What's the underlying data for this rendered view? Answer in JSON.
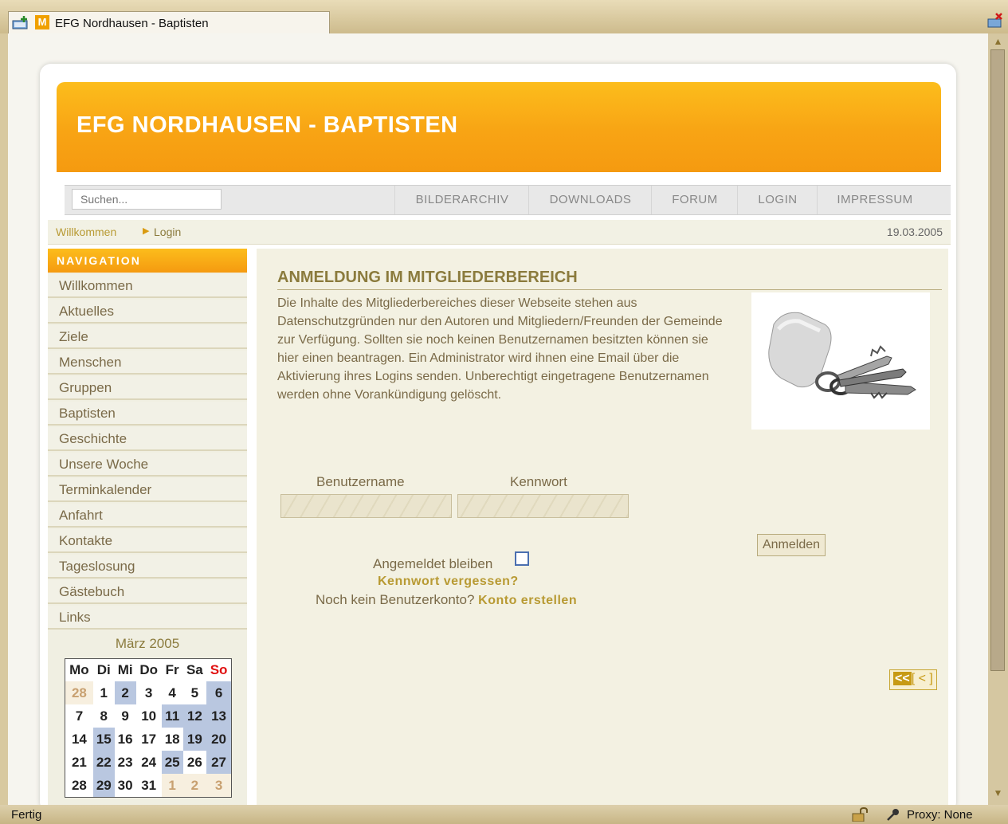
{
  "browser": {
    "tab_title": "EFG Nordhausen - Baptisten",
    "status_text": "Fertig",
    "proxy_text": "Proxy: None"
  },
  "site": {
    "banner_title": "EFG NORDHAUSEN - BAPTISTEN",
    "search_placeholder": "Suchen...",
    "topnav": [
      "BILDERARCHIV",
      "DOWNLOADS",
      "FORUM",
      "LOGIN",
      "IMPRESSUM"
    ],
    "breadcrumb": [
      "Willkommen",
      "Login"
    ],
    "date": "19.03.2005"
  },
  "sidebar": {
    "header": "NAVIGATION",
    "items": [
      "Willkommen",
      "Aktuelles",
      "Ziele",
      "Menschen",
      "Gruppen",
      "Baptisten",
      "Geschichte",
      "Unsere Woche",
      "Terminkalender",
      "Anfahrt",
      "Kontakte",
      "Tageslosung",
      "Gästebuch",
      "Links"
    ]
  },
  "calendar": {
    "title": "März 2005",
    "weekdays": [
      "Mo",
      "Di",
      "Mi",
      "Do",
      "Fr",
      "Sa",
      "So"
    ],
    "weeks": [
      [
        "28",
        "1",
        "2",
        "3",
        "4",
        "5",
        "6"
      ],
      [
        "7",
        "8",
        "9",
        "10",
        "11",
        "12",
        "13"
      ],
      [
        "14",
        "15",
        "16",
        "17",
        "18",
        "19",
        "20"
      ],
      [
        "21",
        "22",
        "23",
        "24",
        "25",
        "26",
        "27"
      ],
      [
        "28",
        "29",
        "30",
        "31",
        "1",
        "2",
        "3"
      ]
    ]
  },
  "login": {
    "heading": "ANMELDUNG IM MITGLIEDERBEREICH",
    "intro": "Die Inhalte des Mitgliederbereiches dieser Webseite stehen aus Datenschutzgründen nur den Autoren und Mitgliedern/Freunden der Gemeinde zur Verfügung. Sollten sie noch keinen Benutzernamen besitzten können sie hier einen beantragen. Ein Administrator wird ihnen eine Email über die Aktivierung ihres Logins senden. Unberechtigt eingetragene Benutzernamen werden ohne Vorankündigung gelöscht.",
    "username_label": "Benutzername",
    "password_label": "Kennwort",
    "username_value": "",
    "password_value": "",
    "submit_label": "Anmelden",
    "remember_label": "Angemeldet bleiben",
    "forgot_label": "Kennwort vergessen?",
    "no_account_label": "Noch kein Benutzerkonto?",
    "create_account_label": "Konto erstellen",
    "pager_first": "<<",
    "pager_prev": "[ < ]"
  }
}
